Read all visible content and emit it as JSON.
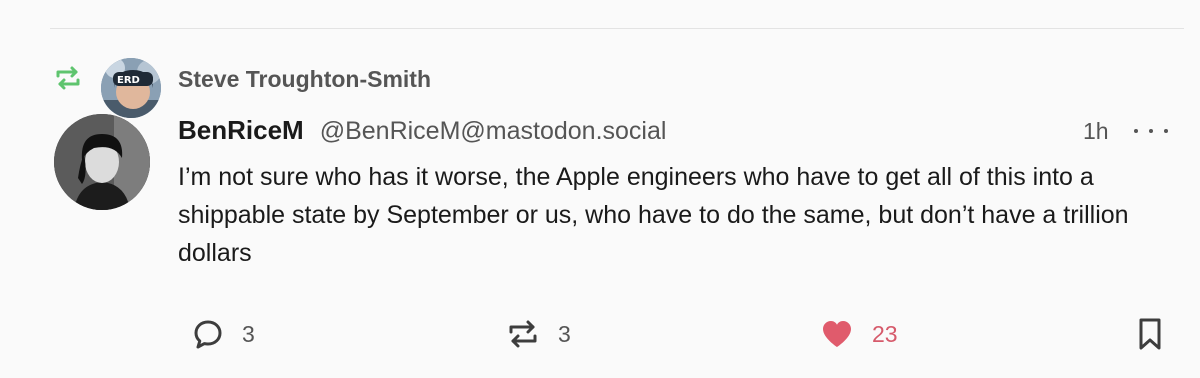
{
  "post": {
    "boosted_by": "Steve Troughton-Smith",
    "author": {
      "display_name": "BenRiceM",
      "handle": "@BenRiceM@mastodon.social"
    },
    "timestamp": "1h",
    "content": "I’m not sure who has it worse, the Apple engineers who have to get all of this into a shippable state by September or us, who have to do the same, but don’t have a trillion dollars",
    "actions": {
      "replies": "3",
      "boosts": "3",
      "favourites": "23"
    }
  },
  "colors": {
    "boost_green": "#5ec46e",
    "favourite_red": "#e05b6c",
    "muted_text": "#555555",
    "text": "#1a1a1a",
    "background": "#fafafa"
  },
  "icons": {
    "boost_indicator": "boost-icon",
    "more": "ellipsis-icon",
    "reply": "reply-icon",
    "boost": "boost-icon",
    "favourite": "heart-icon",
    "bookmark": "bookmark-icon"
  }
}
